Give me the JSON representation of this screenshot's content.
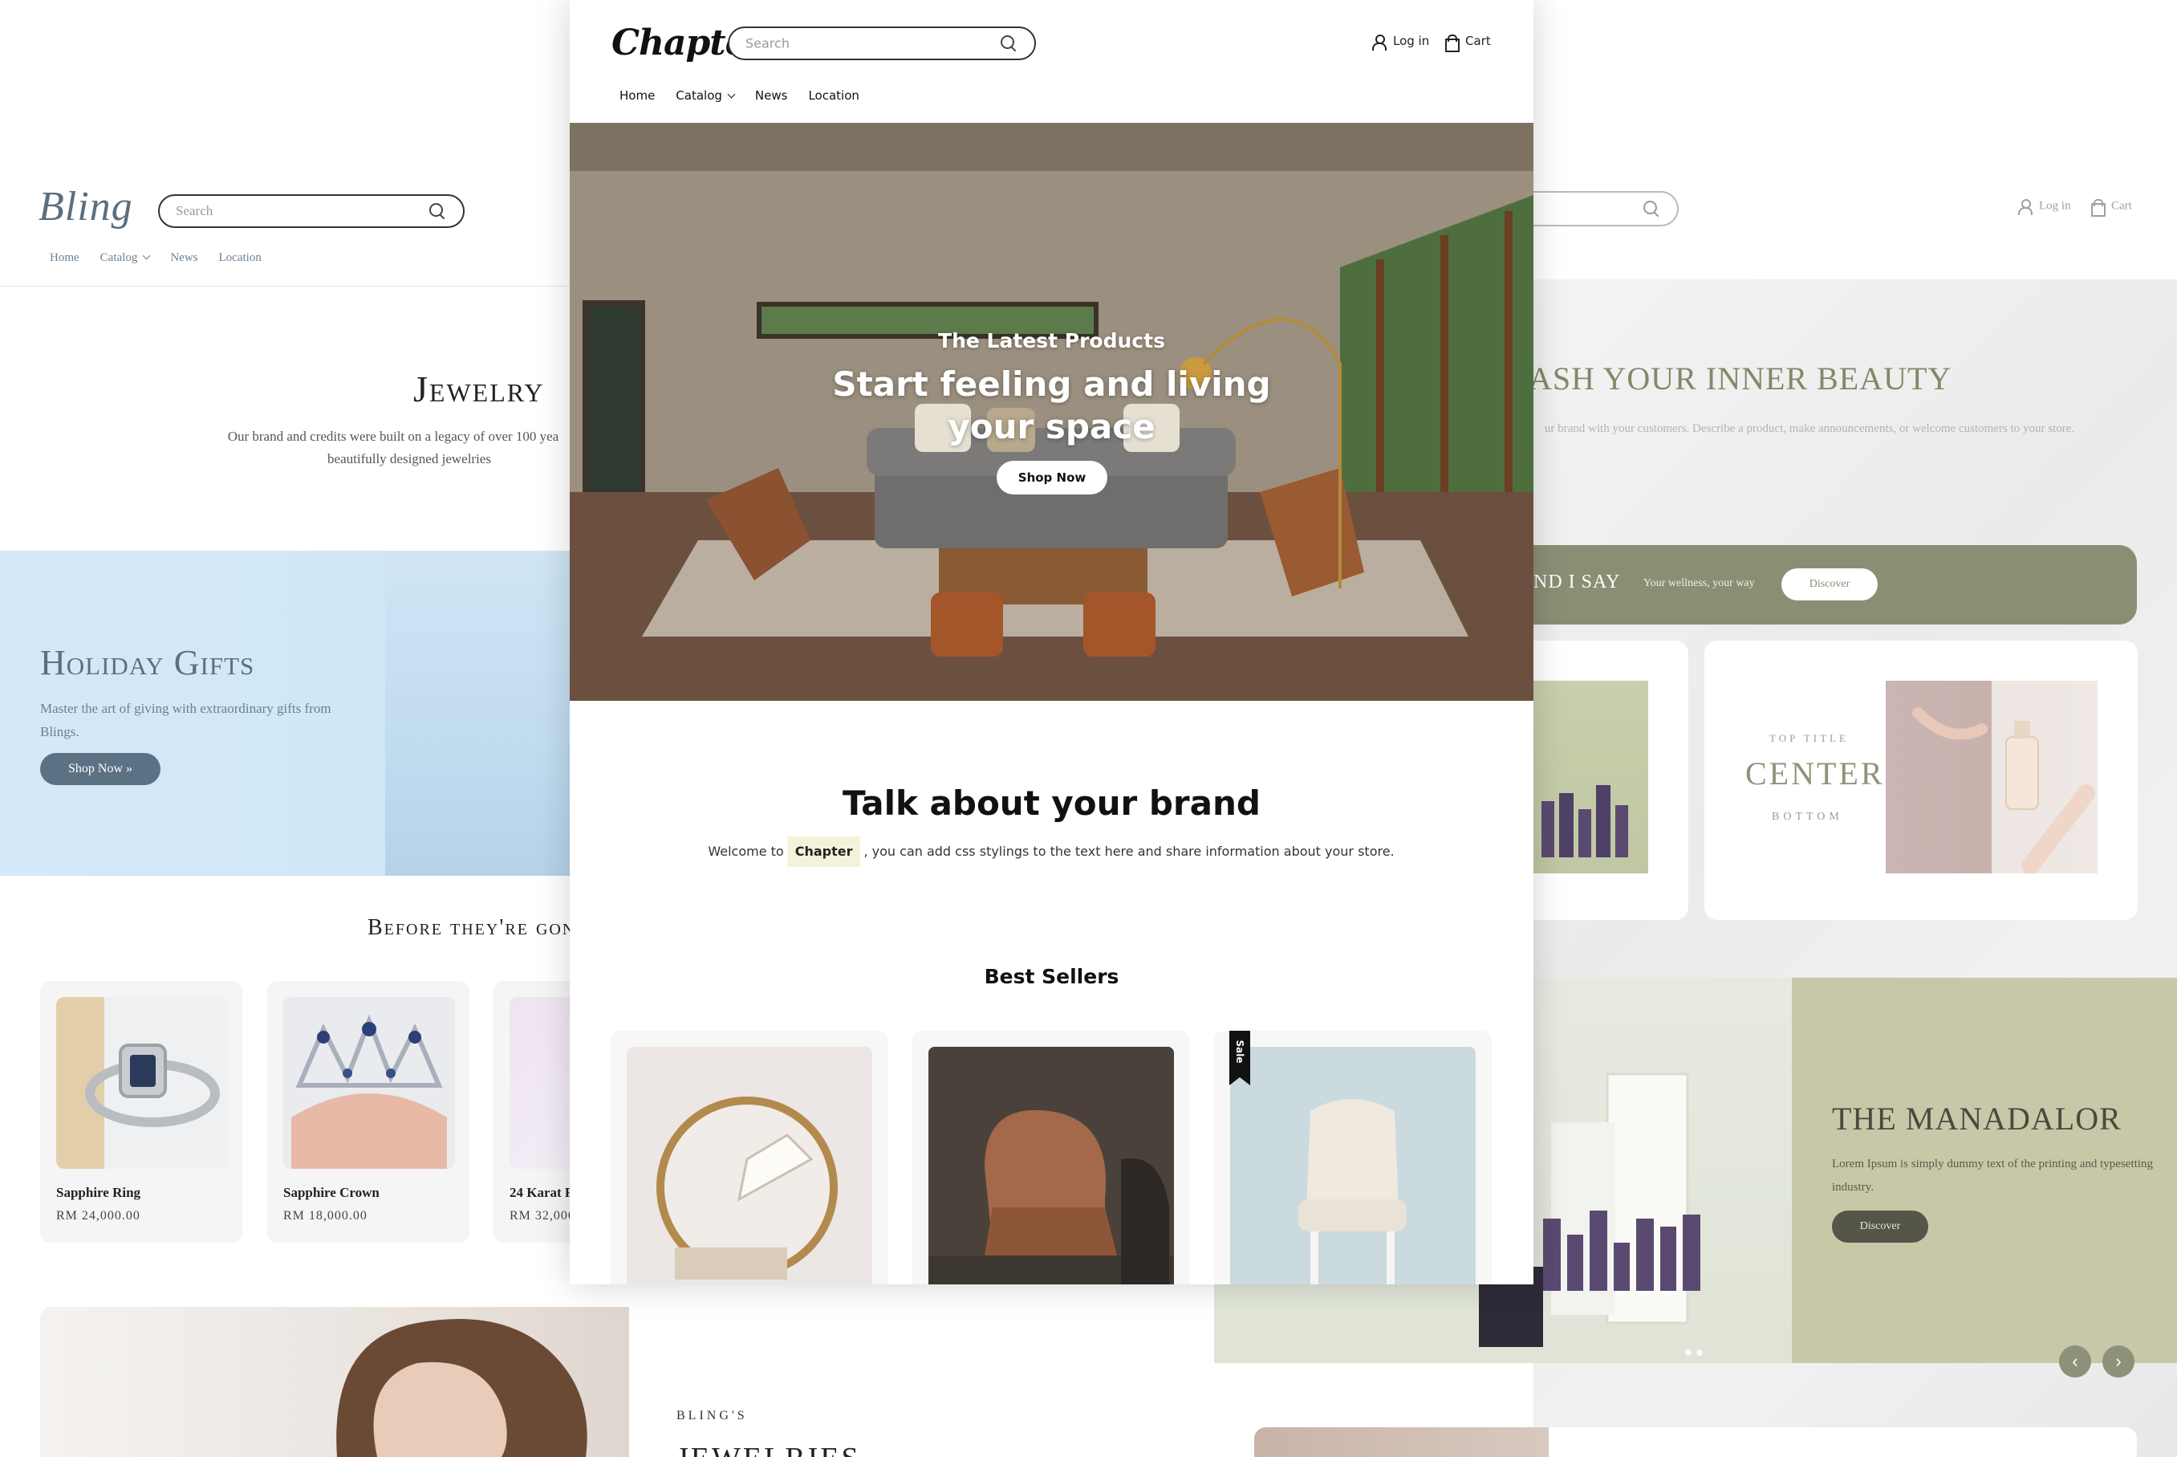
{
  "bling": {
    "logo": "Bling",
    "search_placeholder": "Search",
    "nav": [
      "Home",
      "Catalog",
      "News",
      "Location"
    ],
    "jewelry_title": "Jewelry",
    "jewelry_body_1": "Our brand and credits were built on a legacy of over 100 yea",
    "jewelry_body_2": "beautifully designed jewelries",
    "holiday_title": "Holiday Gifts",
    "holiday_body": "Master the art of giving with extraordinary gifts from Blings.",
    "holiday_button": "Shop Now »",
    "before_title": "Before they're gon",
    "products": [
      {
        "name": "Sapphire Ring",
        "price": "RM 24,000.00"
      },
      {
        "name": "Sapphire Crown",
        "price": "RM 18,000.00"
      },
      {
        "name": "24 Karat R",
        "price": "RM 32,000"
      }
    ],
    "blings_eyebrow": "BLING'S",
    "blings_heading": "JEWELRIES"
  },
  "beauty": {
    "login": "Log in",
    "cart": "Cart",
    "hero_title": "ASH YOUR INNER BEAUTY",
    "hero_body": "ur brand with your customers. Describe a product, make announcements, or welcome customers to your store.",
    "say_title": "ND I SAY",
    "say_sub": "Your wellness, your way",
    "say_button": "Discover",
    "top_title": "TOP TITLE",
    "center": "CENTER",
    "bottom": "BOTTOM",
    "mana_title": "THE MANADALOR",
    "mana_body": "Lorem Ipsum is simply dummy text of the printing and typesetting industry.",
    "mana_button": "Discover",
    "prev_arrow": "‹",
    "next_arrow": "›"
  },
  "chapter": {
    "logo": "Chapter",
    "search_placeholder": "Search",
    "login": "Log in",
    "cart": "Cart",
    "nav": [
      "Home",
      "Catalog",
      "News",
      "Location"
    ],
    "hero_eyebrow": "The Latest Products",
    "hero_title": "Start feeling and living your space",
    "hero_button": "Shop Now",
    "talk_title": "Talk about your brand",
    "talk_prefix": "Welcome to",
    "talk_chip": "Chapter",
    "talk_suffix": ", you can add css stylings to the text here and share information about your store.",
    "best_title": "Best Sellers",
    "sale_label": "Sale"
  },
  "colors": {
    "bling_accent": "#5b7184",
    "beauty_accent": "#8a8f74",
    "manadalor_panel": "#c8c8a9",
    "chapter_chip": "#f5f2dc"
  }
}
